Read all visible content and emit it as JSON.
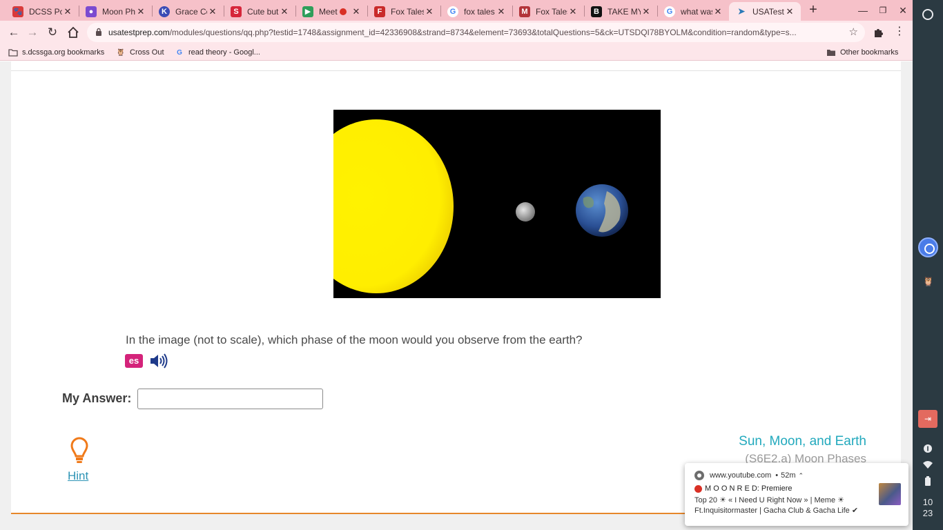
{
  "tabs": [
    {
      "title": "DCSS Por",
      "fav": "bear",
      "color": "#d93a3a"
    },
    {
      "title": "Moon Ph",
      "fav": "person",
      "color": "#7b4bd0"
    },
    {
      "title": "Grace Co",
      "fav": "K",
      "color": "#3b4bb5"
    },
    {
      "title": "Cute but",
      "fav": "S",
      "color": "#d6263a"
    },
    {
      "title": "Meet",
      "fav": "meet",
      "color": "#2f9e5a"
    },
    {
      "title": "Fox Tales",
      "fav": "fox",
      "color": "#c92a2a"
    },
    {
      "title": "fox tales",
      "fav": "G",
      "color": "#4285f4"
    },
    {
      "title": "Fox Tales",
      "fav": "M",
      "color": "#b3343a"
    },
    {
      "title": "TAKE MY",
      "fav": "B",
      "color": "#111111"
    },
    {
      "title": "what was",
      "fav": "G",
      "color": "#4285f4"
    },
    {
      "title": "USATestp",
      "fav": "cursor",
      "color": "#2a7ab8"
    }
  ],
  "toolbar": {
    "url_domain": "usatestprep.com",
    "url_path": "/modules/questions/qq.php?testid=1748&assignment_id=42336908&strand=8734&element=73693&totalQuestions=5&ck=UTSDQI78BYOLM&condition=random&type=s..."
  },
  "bookmarks": {
    "items": [
      {
        "label": "s.dcssga.org bookmarks"
      },
      {
        "label": "Cross Out"
      },
      {
        "label": "read theory - Googl..."
      }
    ],
    "other": "Other bookmarks"
  },
  "question": {
    "text": "In the image (not to scale), which phase of the moon would you observe from the earth?",
    "es_label": "es",
    "answer_label": "My Answer:",
    "answer_value": "",
    "hint_label": "Hint",
    "topic_title": "Sun, Moon, and Earth",
    "topic_sub": "(S6E2.a) Moon Phases"
  },
  "notification": {
    "source": "www.youtube.com",
    "age": "52m",
    "title": "M O O N R E D: Premiere",
    "body": "Top 20 ☀ « I Need U Right Now » | Meme ☀ Ft.Inquisitormaster | Gacha Club & Gacha Life ✔"
  },
  "shelf": {
    "clock_hour": "10",
    "clock_min": "23"
  },
  "colors": {
    "tabstrip": "#f6c1c9",
    "toolbar": "#fde6ea",
    "accent_teal": "#22a9bd",
    "hint_orange": "#f07a1a",
    "sun": "#ffee00"
  }
}
